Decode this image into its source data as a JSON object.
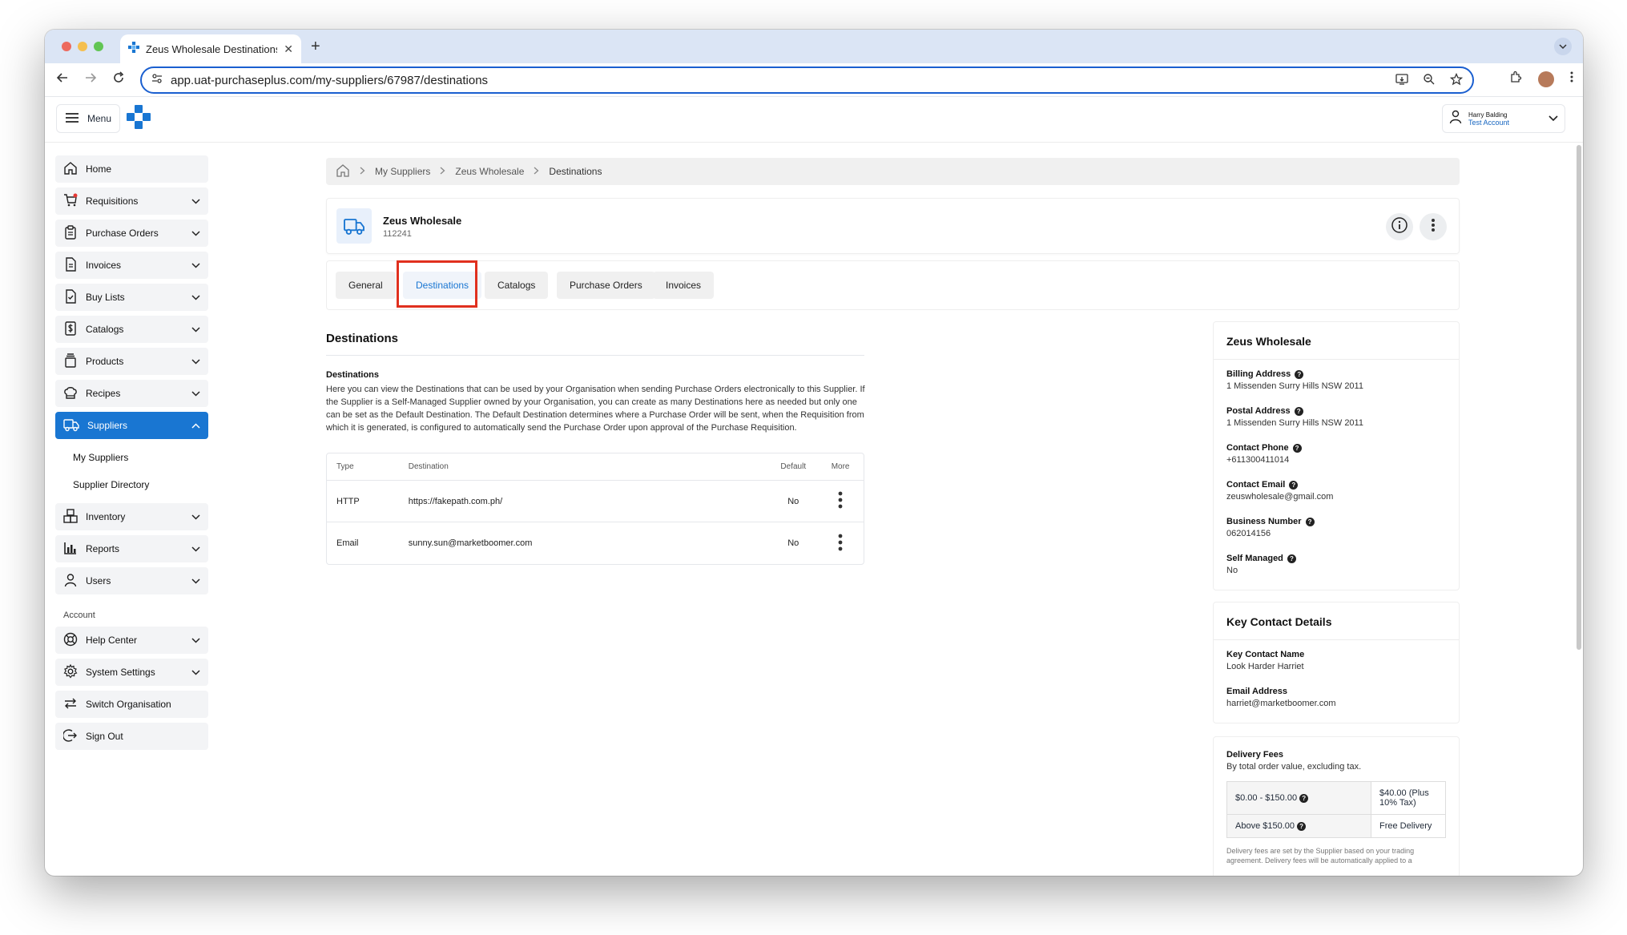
{
  "browser": {
    "tab_title": "Zeus Wholesale Destinations",
    "tab_close": "✕",
    "new_tab": "+",
    "url": "app.uat-purchaseplus.com/my-suppliers/67987/destinations"
  },
  "header": {
    "menu_label": "Menu",
    "user_name": "Harry Balding",
    "user_account": "Test Account"
  },
  "sidebar": {
    "items": [
      {
        "label": "Home",
        "icon": "home-icon"
      },
      {
        "label": "Requisitions",
        "icon": "cart-icon"
      },
      {
        "label": "Purchase Orders",
        "icon": "clipboard-icon"
      },
      {
        "label": "Invoices",
        "icon": "document-icon"
      },
      {
        "label": "Buy Lists",
        "icon": "checklist-icon"
      },
      {
        "label": "Catalogs",
        "icon": "dollar-doc-icon"
      },
      {
        "label": "Products",
        "icon": "stack-icon"
      },
      {
        "label": "Recipes",
        "icon": "chef-hat-icon"
      },
      {
        "label": "Suppliers",
        "icon": "truck-icon"
      }
    ],
    "sub_items": [
      "My Suppliers",
      "Supplier Directory"
    ],
    "items2": [
      {
        "label": "Inventory",
        "icon": "boxes-icon"
      },
      {
        "label": "Reports",
        "icon": "bar-chart-icon"
      },
      {
        "label": "Users",
        "icon": "user-icon"
      }
    ],
    "account_label": "Account",
    "account_items": [
      {
        "label": "Help Center",
        "icon": "lifebuoy-icon"
      },
      {
        "label": "System Settings",
        "icon": "gear-icon"
      },
      {
        "label": "Switch Organisation",
        "icon": "switch-arrows-icon"
      },
      {
        "label": "Sign Out",
        "icon": "sign-out-icon"
      }
    ]
  },
  "breadcrumb": {
    "items": [
      "My Suppliers",
      "Zeus Wholesale",
      "Destinations"
    ]
  },
  "supplier": {
    "name": "Zeus Wholesale",
    "number": "112241"
  },
  "tabs": [
    "General",
    "Destinations",
    "Catalogs",
    "Purchase Orders",
    "Invoices"
  ],
  "destinations": {
    "title": "Destinations",
    "subtitle": "Destinations",
    "description": "Here you can view the Destinations that can be used by your Organisation when sending Purchase Orders electronically to this Supplier. If the Supplier is a Self-Managed Supplier owned by your Organisation, you can create as many Destinations here as needed but only one can be set as the Default Destination. The Default Destination determines where a Purchase Order will be sent, when the Requisition from which it is generated, is configured to automatically send the Purchase Order upon approval of the Purchase Requisition.",
    "columns": [
      "Type",
      "Destination",
      "Default",
      "More"
    ],
    "rows": [
      {
        "type": "HTTP",
        "destination": "https://fakepath.com.ph/",
        "default": "No"
      },
      {
        "type": "Email",
        "destination": "sunny.sun@marketboomer.com",
        "default": "No"
      }
    ]
  },
  "details": {
    "title": "Zeus Wholesale",
    "fields": [
      {
        "label": "Billing Address",
        "value": "1 Missenden Surry Hills NSW 2011"
      },
      {
        "label": "Postal Address",
        "value": "1 Missenden Surry Hills NSW 2011"
      },
      {
        "label": "Contact Phone",
        "value": "+611300411014"
      },
      {
        "label": "Contact Email",
        "value": "zeuswholesale@gmail.com"
      },
      {
        "label": "Business Number",
        "value": "062014156"
      },
      {
        "label": "Self Managed",
        "value": "No"
      }
    ]
  },
  "key_contact": {
    "title": "Key Contact Details",
    "fields": [
      {
        "label": "Key Contact Name",
        "value": "Look Harder Harriet"
      },
      {
        "label": "Email Address",
        "value": "harriet@marketboomer.com"
      }
    ]
  },
  "delivery_fees": {
    "title": "Delivery Fees",
    "subtitle": "By total order value, excluding tax.",
    "rows": [
      {
        "range": "$0.00 - $150.00",
        "fee": "$40.00 (Plus 10% Tax)"
      },
      {
        "range": "Above $150.00",
        "fee": "Free Delivery"
      }
    ],
    "note": "Delivery fees are set by the Supplier based on your trading agreement. Delivery fees will be automatically applied to a"
  },
  "colors": {
    "accent": "#1976d2",
    "highlight": "#e0301e"
  }
}
